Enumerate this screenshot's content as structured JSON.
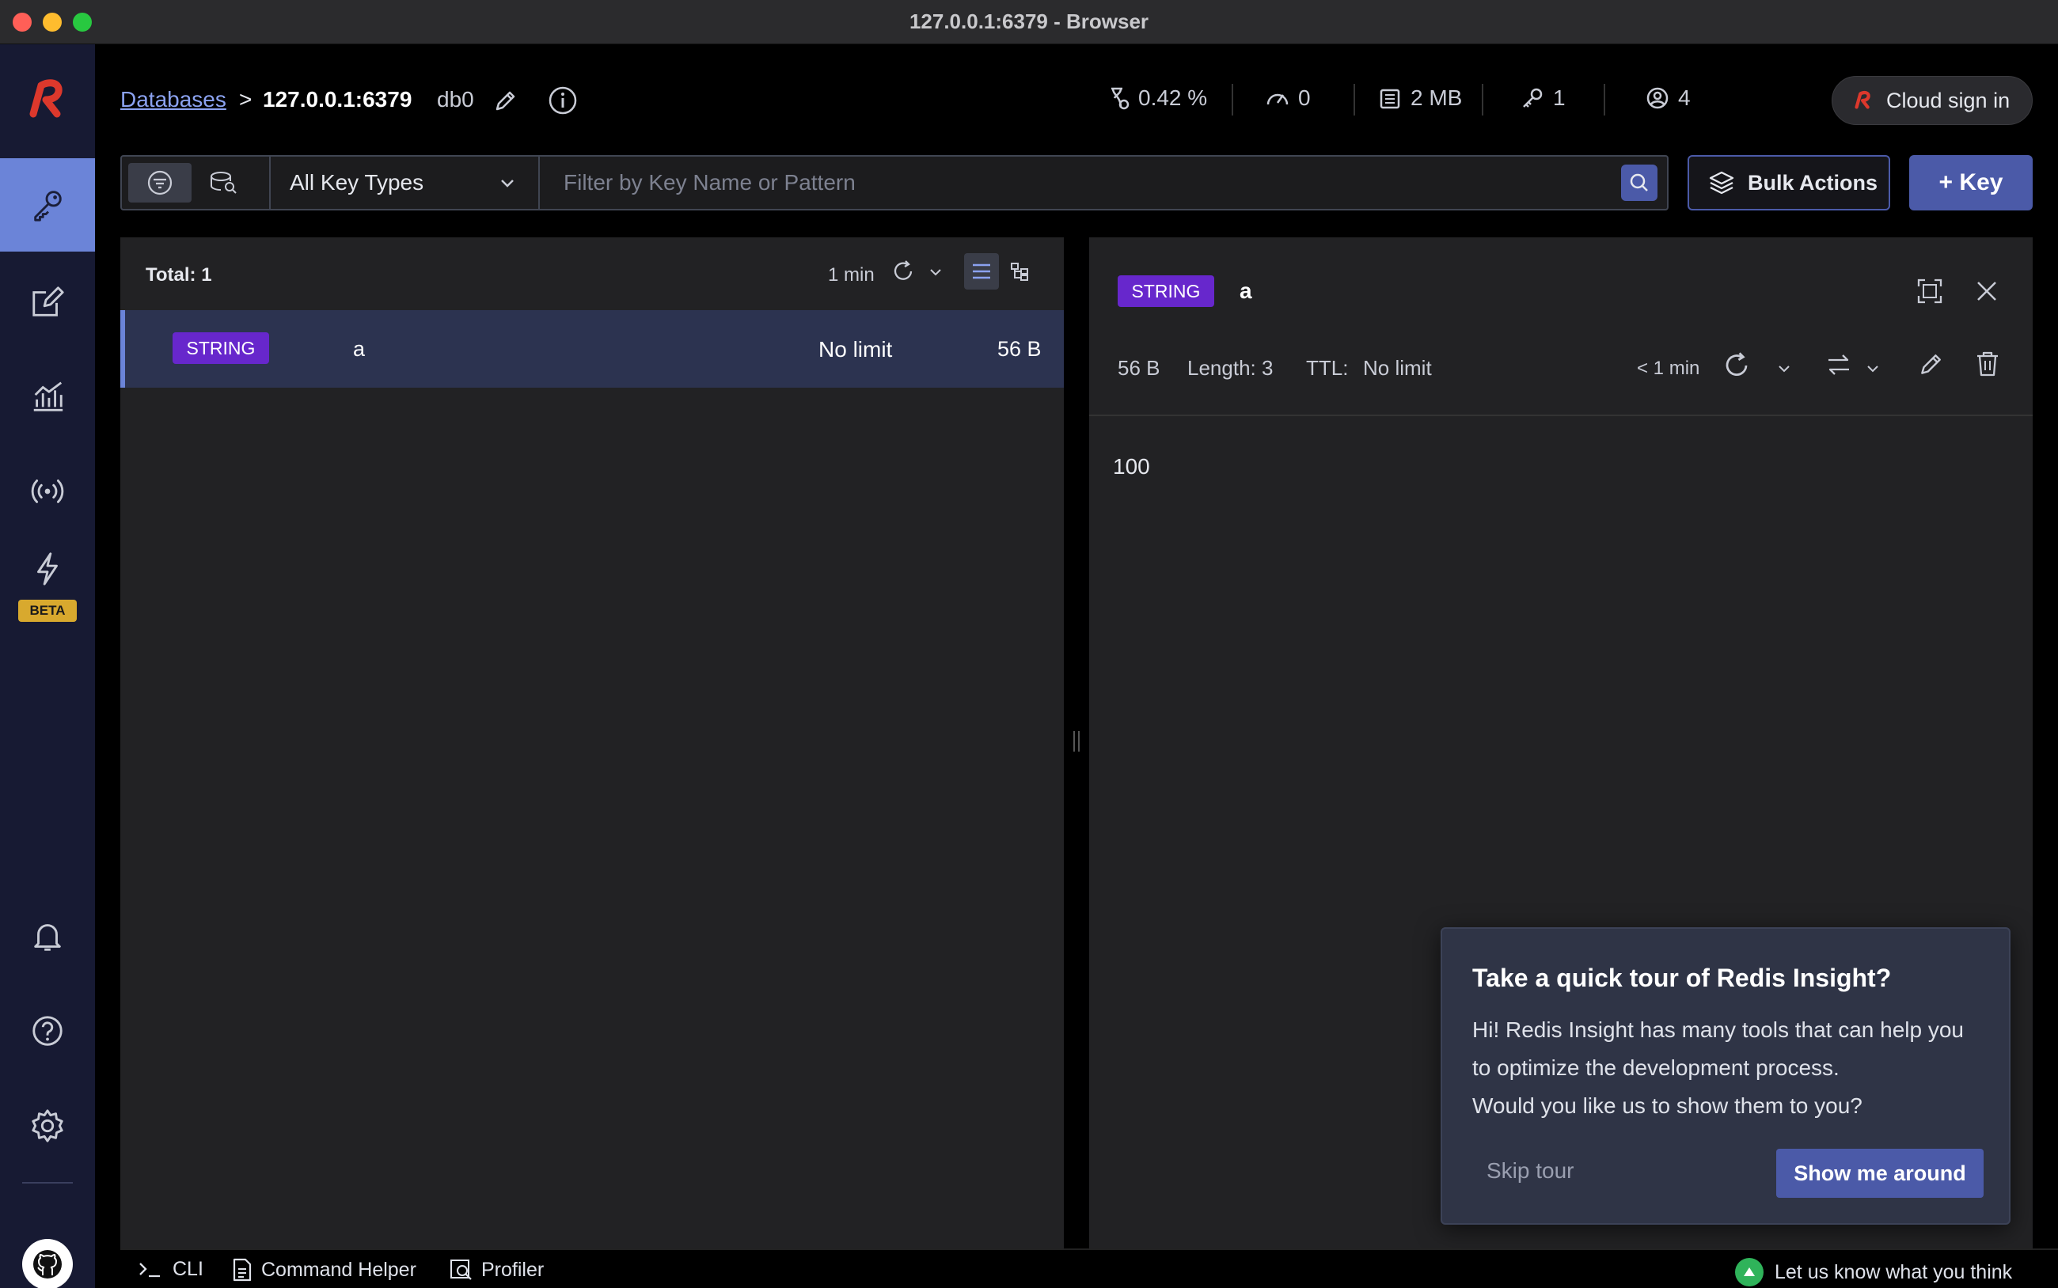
{
  "window": {
    "title": "127.0.0.1:6379 - Browser"
  },
  "header": {
    "breadcrumb_link": "Databases",
    "breadcrumb_sep": ">",
    "host": "127.0.0.1:6379",
    "db": "db0",
    "stats": {
      "cpu": "0.42 %",
      "ops": "0",
      "memory": "2 MB",
      "keys": "1",
      "clients": "4"
    },
    "cloud_label": "Cloud sign in"
  },
  "filter": {
    "key_type": "All Key Types",
    "placeholder": "Filter by Key Name or Pattern",
    "bulk_label": "Bulk Actions",
    "add_key_label": "+ Key"
  },
  "key_list": {
    "total": "Total: 1",
    "refresh_time": "1 min",
    "rows": [
      {
        "type": "STRING",
        "name": "a",
        "ttl": "No limit",
        "size": "56 B"
      }
    ]
  },
  "details": {
    "type": "STRING",
    "key": "a",
    "size": "56 B",
    "length": "Length: 3",
    "ttl_label": "TTL:",
    "ttl_value": "No limit",
    "refresh_time": "< 1 min",
    "value": "100"
  },
  "tour": {
    "title": "Take a quick tour of Redis Insight?",
    "line1": "Hi! Redis Insight has many tools that can help you",
    "line2": "to optimize the development process.",
    "line3": "Would you like us to show them to you?",
    "skip_label": "Skip tour",
    "show_label": "Show me around"
  },
  "bottom": {
    "cli_label": "CLI",
    "helper_label": "Command Helper",
    "profiler_label": "Profiler",
    "feedback_label": "Let us know what you think"
  },
  "nav": {
    "beta_label": "BETA"
  },
  "colors": {
    "accent": "#4b5aa8",
    "string_badge": "#6727cc",
    "nav_bg": "#171a33",
    "nav_active": "#6b84d8",
    "redis_red": "#dc382c"
  }
}
